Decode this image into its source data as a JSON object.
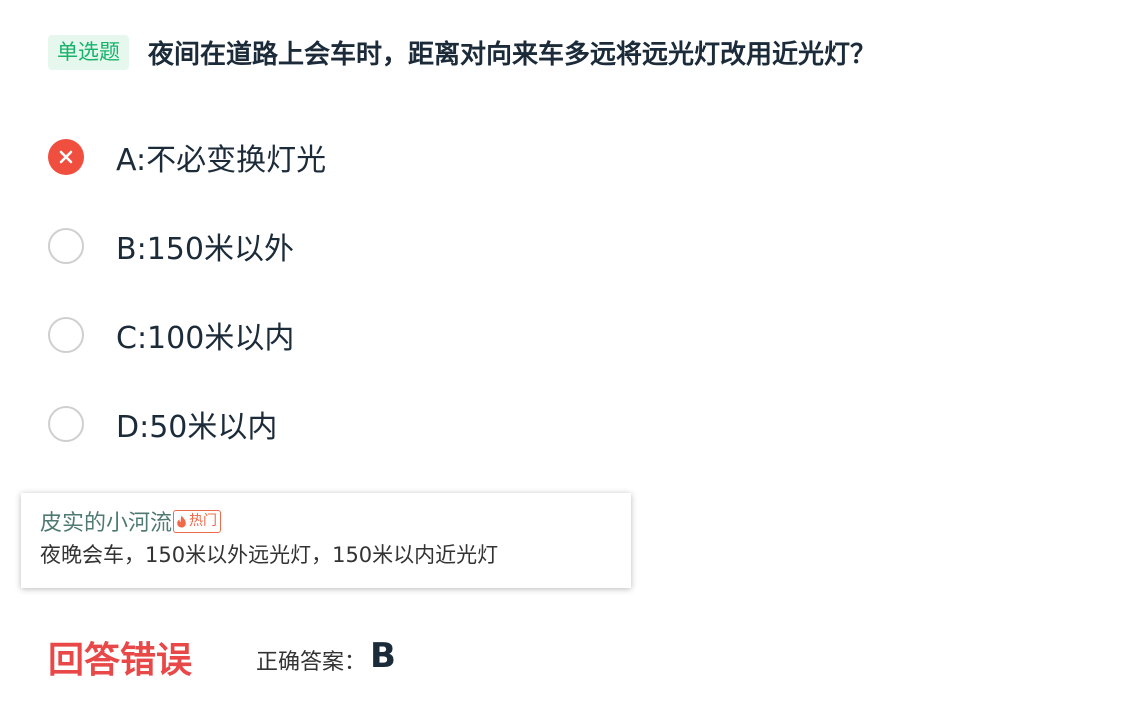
{
  "question": {
    "type_tag": "单选题",
    "text": "夜间在道路上会车时，距离对向来车多远将远光灯改用近光灯？"
  },
  "options": [
    {
      "label": "A:不必变换灯光",
      "state": "wrong",
      "icon": "close-icon"
    },
    {
      "label": "B:150米以外",
      "state": "unselected",
      "icon": "radio-empty-icon"
    },
    {
      "label": "C:100米以内",
      "state": "unselected",
      "icon": "radio-empty-icon"
    },
    {
      "label": "D:50米以内",
      "state": "unselected",
      "icon": "radio-empty-icon"
    }
  ],
  "comment": {
    "user": "皮实的小河流",
    "badge": "热门",
    "badge_icon": "flame-icon",
    "text": "夜晚会车，150米以外远光灯，150米以内近光灯"
  },
  "result": {
    "status": "回答错误",
    "correct_label": "正确答案：",
    "correct_answer": "B"
  },
  "colors": {
    "tag_bg": "#e6f7ee",
    "tag_text": "#17b36b",
    "wrong": "#f04e3e",
    "status_error": "#e84848",
    "comment_user": "#4f7a73",
    "hot_badge": "#f06a4a"
  }
}
